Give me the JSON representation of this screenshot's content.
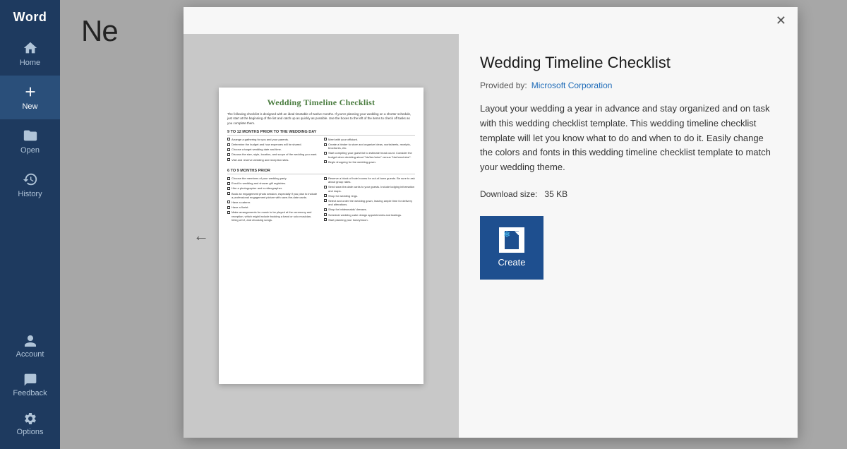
{
  "app": {
    "name": "Word"
  },
  "sidebar": {
    "items": [
      {
        "id": "home",
        "label": "Home",
        "icon": "home"
      },
      {
        "id": "new",
        "label": "New",
        "icon": "new",
        "active": true
      },
      {
        "id": "open",
        "label": "Open",
        "icon": "open"
      },
      {
        "id": "history",
        "label": "History",
        "icon": "history"
      }
    ],
    "bottom_items": [
      {
        "id": "account",
        "label": "Account"
      },
      {
        "id": "feedback",
        "label": "Feedback"
      },
      {
        "id": "options",
        "label": "Options"
      }
    ]
  },
  "main": {
    "title": "Ne"
  },
  "modal": {
    "close_label": "✕",
    "back_label": "← Back",
    "template": {
      "title": "Wedding Timeline Checklist",
      "preview_title": "Wedding Timeline Checklist",
      "provider_label": "Provided by:",
      "provider_name": "Microsoft Corporation",
      "description": "Layout your wedding a year in advance and stay organized and on task with this wedding checklist template. This wedding timeline checklist template will let you know what to do and when to do it. Easily change the colors and fonts in this wedding timeline checklist template to match your wedding theme.",
      "download_label": "Download size:",
      "download_size": "35 KB",
      "create_label": "Create",
      "sections": [
        {
          "title": "9 TO 12 MONTHS PRIOR TO THE WEDDING DAY",
          "left_items": [
            "Arrange a gathering for you and your parents.",
            "Determine the budget and how expenses will be shared.",
            "Choose a target wedding date and time.",
            "Discuss the size, style, location, and scope of the wedding you want.",
            "Visit and reserve wedding and reception sites."
          ],
          "right_items": [
            "Meet with your officiant.",
            "Create a binder to store and organize ideas, worksheets, receipts, brochures, etc.",
            "Start compiling your guest list to estimate head count. Consider the budget when deciding about \"his/her/mine\" versus \"his/hers/mine\".",
            "Begin shopping for the wedding gown."
          ]
        },
        {
          "title": "6 TO 9 MONTHS PRIOR",
          "left_items": [
            "Choose the members of your wedding party.",
            "Enroll in wedding and shower gift registries.",
            "Hire a photographer and a videographer.",
            "Book an engagement photo session, especially if you plan to include a professional engagement picture with save-the-date cards.",
            "Have a caterer.",
            "Have a florist.",
            "Make arrangements for music to be played at the ceremony and reception, which might include booking a band or solo musician, hiring a DJ, and choosing songs."
          ],
          "right_items": [
            "Reserve a block of hotel rooms for out-of-town guests. Be sure to ask about group rates.",
            "Send save-the-date cards to your guests. Include lodging information and maps.",
            "Shop for wedding rings.",
            "Select and order the wedding gown, leaving ample time for delivery and alterations.",
            "Shop for bridesmaids' dresses.",
            "Schedule wedding cake design appointments and tastings.",
            "Start planning your honeymoon."
          ]
        }
      ]
    }
  }
}
